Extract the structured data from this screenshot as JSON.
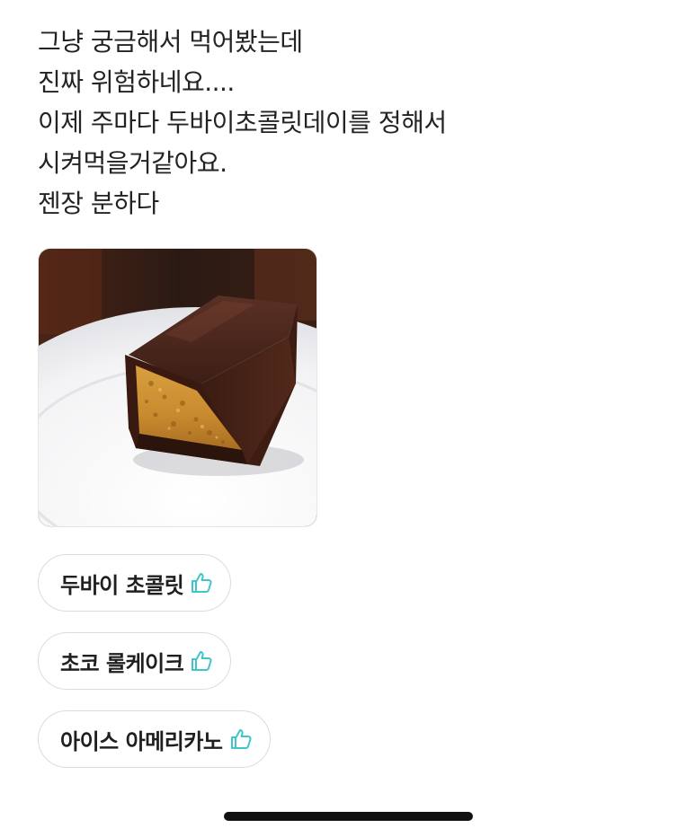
{
  "post": {
    "lines": [
      "그냥 궁금해서 먹어봤는데",
      "진짜 위험하네요....",
      "이제 주마다 두바이초콜릿데이를 정해서",
      "시켜먹을거같아요.",
      "젠장 분하다"
    ]
  },
  "photo": {
    "subject": "chocolate-bar-on-plate"
  },
  "menu_items": [
    {
      "label": "두바이 초콜릿",
      "icon": "thumbs-up-icon"
    },
    {
      "label": "초코 롤케이크",
      "icon": "thumbs-up-icon"
    },
    {
      "label": "아이스 아메리카노",
      "icon": "thumbs-up-icon"
    }
  ],
  "colors": {
    "accent": "#3ec6c8",
    "chip_border": "#dcdcdc",
    "text": "#232323"
  }
}
